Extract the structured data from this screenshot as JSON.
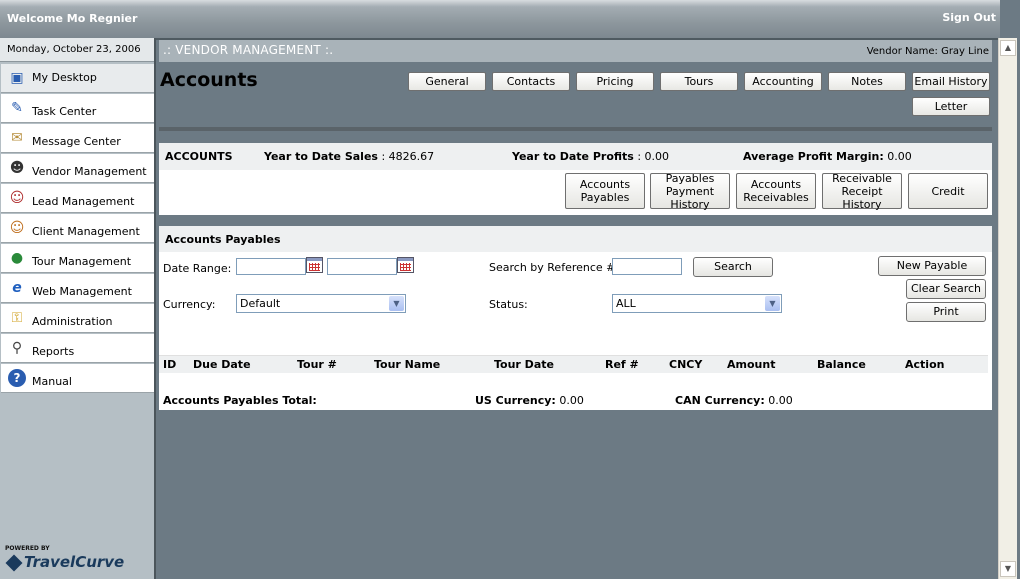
{
  "header": {
    "welcome": "Welcome Mo Regnier",
    "signout": "Sign Out"
  },
  "sidebar": {
    "date": "Monday, October 23, 2006",
    "items": [
      {
        "label": "My Desktop",
        "icon": "desktop-icon"
      },
      {
        "label": "Task Center",
        "icon": "task-icon"
      },
      {
        "label": "Message Center",
        "icon": "envelope-icon"
      },
      {
        "label": "Vendor Management",
        "icon": "vendor-icon"
      },
      {
        "label": "Lead Management",
        "icon": "lead-icon"
      },
      {
        "label": "Client Management",
        "icon": "clients-icon"
      },
      {
        "label": "Tour Management",
        "icon": "globe-icon"
      },
      {
        "label": "Web Management",
        "icon": "web-icon"
      },
      {
        "label": "Administration",
        "icon": "lock-icon"
      },
      {
        "label": "Reports",
        "icon": "magnifier-icon"
      },
      {
        "label": "Manual",
        "icon": "help-icon"
      }
    ],
    "powered_by": "POWERED BY",
    "brand": "TravelCurve"
  },
  "main": {
    "section_title": ".: VENDOR MANAGEMENT :.",
    "vendor_name": "Vendor Name: Gray Line",
    "page_title": "Accounts",
    "tabs": [
      "General",
      "Contacts",
      "Pricing",
      "Tours",
      "Accounting",
      "Notes",
      "Email History",
      "Letter"
    ]
  },
  "summary": {
    "label": "ACCOUNTS",
    "ytd_sales_label": "Year to Date Sales",
    "ytd_sales_value": ": 4826.67",
    "ytd_profits_label": "Year to Date Profits",
    "ytd_profits_value": ": 0.00",
    "avg_margin_label": "Average Profit Margin:",
    "avg_margin_value": " 0.00",
    "buttons": [
      {
        "line1": "Accounts",
        "line2": "Payables"
      },
      {
        "line1": "Payables",
        "line2": "Payment History"
      },
      {
        "line1": "Accounts",
        "line2": "Receivables"
      },
      {
        "line1": "Receivable",
        "line2": "Receipt History"
      },
      {
        "line1": "Credit",
        "line2": ""
      }
    ]
  },
  "payables": {
    "title": "Accounts Payables",
    "date_range_label": "Date Range:",
    "date_from": "",
    "date_to": "",
    "search_ref_label": "Search by Reference #:",
    "search_ref_value": "",
    "search_button": "Search",
    "currency_label": "Currency:",
    "currency_value": "Default",
    "status_label": "Status:",
    "status_value": "ALL",
    "new_payable": "New Payable",
    "clear_search": "Clear Search",
    "print": "Print",
    "columns": [
      "ID",
      "Due Date",
      "Tour #",
      "Tour Name",
      "Tour Date",
      "Ref #",
      "CNCY",
      "Amount",
      "Balance",
      "Action"
    ],
    "total_label": "Accounts Payables Total:",
    "us_label": "US Currency:",
    "us_value": " 0.00",
    "can_label": "CAN Currency:",
    "can_value": " 0.00"
  }
}
